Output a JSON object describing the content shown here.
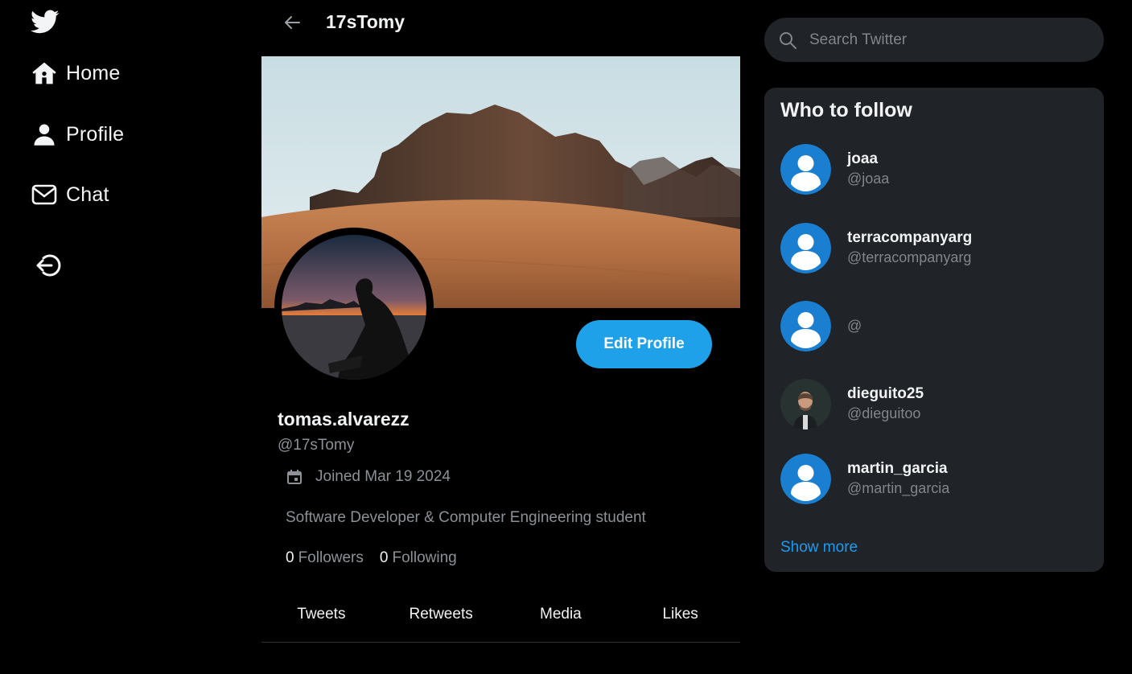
{
  "nav": {
    "logo_icon": "twitter-bird-icon",
    "items": [
      {
        "label": "Home",
        "icon": "home-icon"
      },
      {
        "label": "Profile",
        "icon": "person-icon"
      },
      {
        "label": "Chat",
        "icon": "mail-icon"
      }
    ],
    "logout_icon": "logout-icon"
  },
  "header": {
    "title": "17sTomy",
    "back_icon": "arrow-left-icon"
  },
  "profile": {
    "edit_label": "Edit Profile",
    "display_name": "tomas.alvarezz",
    "handle": "@17sTomy",
    "joined": "Joined Mar 19 2024",
    "bio": "Software Developer & Computer Engineering student",
    "followers_count": "0",
    "followers_label": "Followers",
    "following_count": "0",
    "following_label": "Following"
  },
  "tabs": [
    "Tweets",
    "Retweets",
    "Media",
    "Likes"
  ],
  "search": {
    "placeholder": "Search Twitter"
  },
  "who_to_follow": {
    "title": "Who to follow",
    "users": [
      {
        "name": "joaa",
        "handle": "@joaa"
      },
      {
        "name": "terracompanyarg",
        "handle": "@terracompanyarg"
      },
      {
        "name": "",
        "handle": "@"
      },
      {
        "name": "dieguito25",
        "handle": "@dieguitoo"
      },
      {
        "name": "martin_garcia",
        "handle": "@martin_garcia"
      }
    ],
    "show_more": "Show more"
  },
  "colors": {
    "accent": "#1d9bf0",
    "default_avatar_bg": "#1a7fd0",
    "panel_bg": "#202327",
    "muted_text": "#8b9197"
  }
}
